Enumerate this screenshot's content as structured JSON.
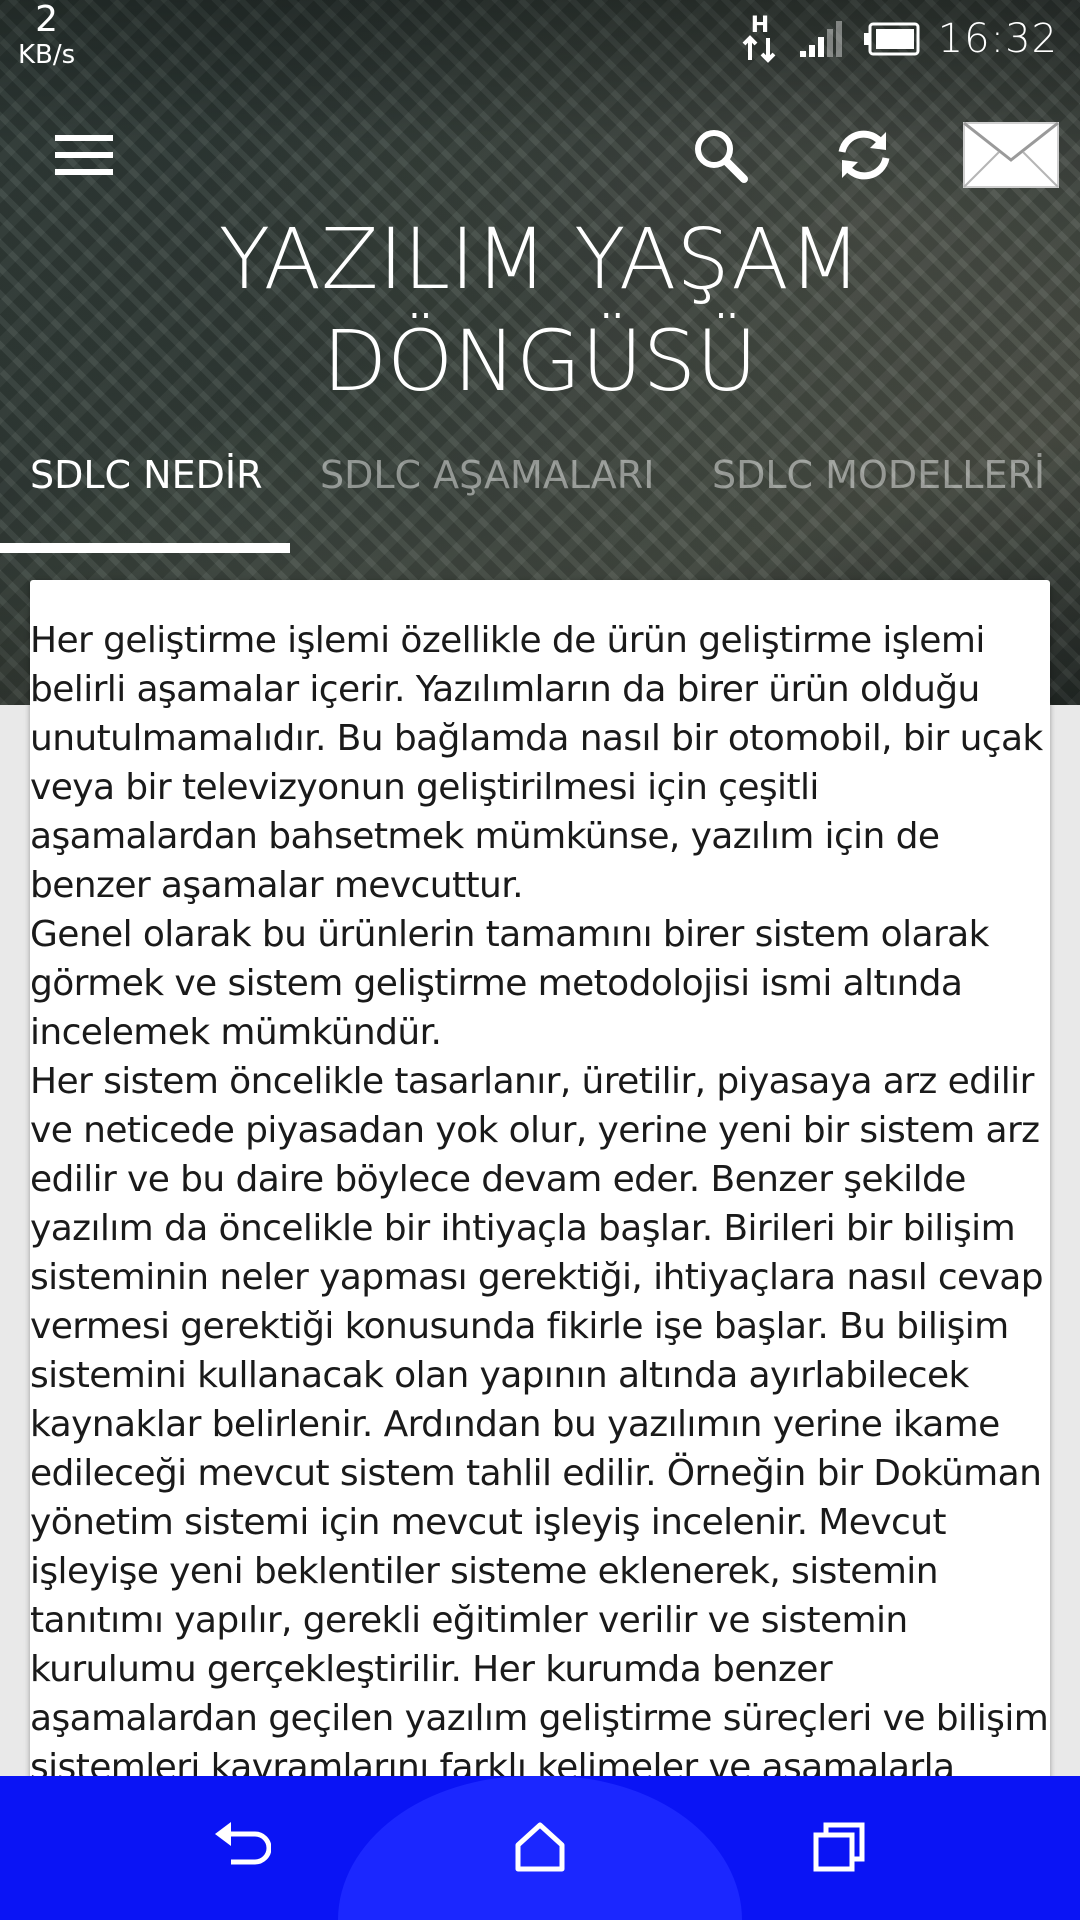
{
  "status_bar": {
    "net_speed_value": "2",
    "net_speed_unit": "KB/s",
    "network_type": "H",
    "clock": "16:32",
    "icons": [
      "data-transfer-icon",
      "signal-icon",
      "battery-icon"
    ]
  },
  "toolbar": {
    "title_line1": "YAZILIM YAŞAM",
    "title_line2": "DÖNGÜSÜ",
    "icons": [
      "menu-icon",
      "search-icon",
      "refresh-icon",
      "mail-icon"
    ]
  },
  "tabs": [
    {
      "label": "SDLC NEDİR",
      "active": true
    },
    {
      "label": "SDLC AŞAMALARI",
      "active": false
    },
    {
      "label": "SDLC MODELLERİ",
      "active": false
    }
  ],
  "content": {
    "text": "Her geliştirme işlemi özellikle de ürün geliştirme işlemi belirli aşamalar içerir. Yazılımların da birer ürün olduğu unutulmamalıdır. Bu bağlamda nasıl bir otomobil, bir uçak veya bir televizyonun geliştirilmesi için çeşitli aşamalardan bahsetmek mümkünse, yazılım için de benzer aşamalar mevcuttur.\n Genel olarak bu ürünlerin tamamını birer sistem olarak görmek ve sistem geliştirme metodolojisi ismi altında incelemek mümkündür.\n Her sistem öncelikle tasarlanır, üretilir, piyasaya arz edilir ve neticede piyasadan yok olur, yerine yeni bir sistem arz edilir ve bu daire böylece devam eder. Benzer şekilde yazılım da öncelikle bir ihtiyaçla başlar. Birileri bir bilişim sisteminin neler yapması gerektiği, ihtiyaçlara nasıl cevap vermesi gerektiği konusunda fikirle işe başlar. Bu bilişim sistemini kullanacak olan yapının altında ayırlabilecek kaynaklar belirlenir. Ardından bu yazılımın yerine ikame edileceği mevcut sistem tahlil edilir. Örneğin bir Doküman yönetim sistemi için mevcut işleyiş incelenir. Mevcut işleyişe yeni beklentiler sisteme eklenerek, sistemin tanıtımı yapılır, gerekli eğitimler verilir ve sistemin kurulumu gerçekleştirilir. Her kurumda benzer aşamalardan geçilen yazılım geliştirme süreçleri ve bilişim sistemleri kavramlarını farklı kelimeler ve aşamalarla anlatmak mümkündür."
  },
  "colors": {
    "nav_bar": "#0a14f5",
    "nav_home_highlight": "#1b27ff",
    "card_background": "#ffffff",
    "page_background": "#e9e9e9",
    "tab_active": "#ffffff"
  },
  "nav_bar": {
    "icons": [
      "back-icon",
      "home-icon",
      "recent-apps-icon"
    ]
  }
}
